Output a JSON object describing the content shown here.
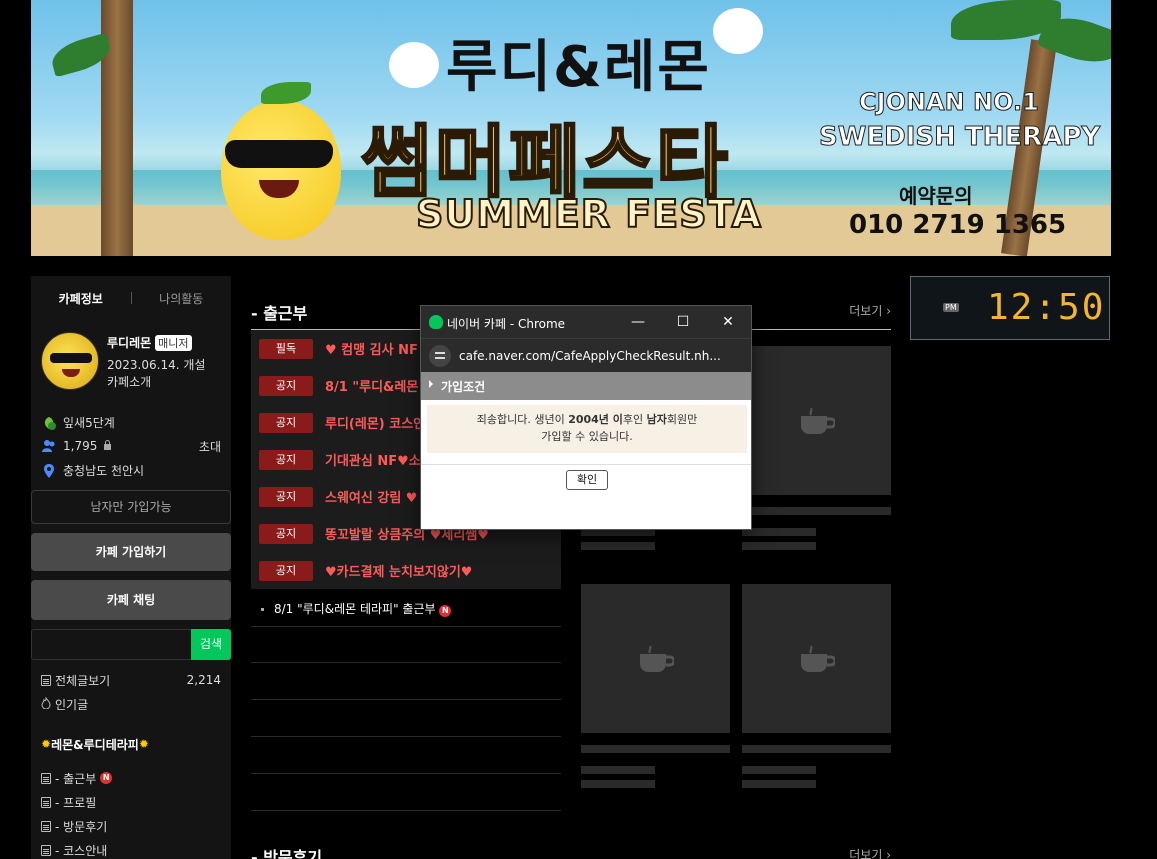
{
  "banner": {
    "title_top": "루디&레몬",
    "title_main": "썸머페스타",
    "title_en": "SUMMER FESTA",
    "side_line1": "CJONAN NO.1",
    "side_line2": "SWEDISH THERAPY",
    "reserve_label": "예약문의",
    "phone": "010 2719 1365"
  },
  "sidebar": {
    "tab_info": "카페정보",
    "tab_activity": "나의활동",
    "cafe_name": "루디레몬",
    "manager_badge": "매니저",
    "created": "2023.06.14. 개설",
    "intro": "카페소개",
    "level": "잎새5단계",
    "members": "1,795",
    "invite": "초대",
    "location": "충청남도 천안시",
    "only_men": "남자만 가입가능",
    "join_button": "카페 가입하기",
    "chat_button": "카페 채팅",
    "search_placeholder": "",
    "search_button": "검색",
    "menu_all": "전체글보기",
    "menu_all_count": "2,214",
    "menu_popular": "인기글",
    "menu_group": "레몬&루디테라피",
    "menu_items": [
      "- 출근부",
      "- 프로필",
      "- 방문후기",
      "- 코스안내"
    ]
  },
  "board": {
    "title": "- 출근부",
    "more": "더보기",
    "notices": [
      {
        "tag": "필독",
        "text": "♥ 컴맹 김사 NF"
      },
      {
        "tag": "공지",
        "text": "8/1 \"루디&레몬"
      },
      {
        "tag": "공지",
        "text": "루디(레몬) 코스인"
      },
      {
        "tag": "공지",
        "text": "기대관심 NF♥소"
      },
      {
        "tag": "공지",
        "text": "스웨여신 강림 ♥"
      },
      {
        "tag": "공지",
        "text": "똥꼬발랄 상큼주의 ♥세리쌤♥"
      },
      {
        "tag": "공지",
        "text": "♥카드결제 눈치보지않기♥"
      }
    ],
    "post": "8/1 \"루디&레몬 테라피\" 출근부",
    "new_mark": "N",
    "board2_title": "- 방문후기",
    "board2_more": "더보기"
  },
  "clock": {
    "ampm": "PM",
    "time": "12:50"
  },
  "popup": {
    "window_title": "네이버 카페 - Chrome",
    "url": "cafe.naver.com/CafeApplyCheckResult.nh...",
    "section_title": "가입조건",
    "msg_line1_pre": "죄송합니다. 생년이 ",
    "msg_year": "2004년 이",
    "msg_line1_mid": "후인 ",
    "msg_male": "남자",
    "msg_line1_post": "회원만",
    "msg_line2": "가입할 수 있습니다.",
    "ok_button": "확인"
  },
  "colors": {
    "accent_green": "#03c75a",
    "notice_red": "#ff5a5a",
    "tag_red": "#8b1a1a",
    "clock_orange": "#f5b62a"
  }
}
